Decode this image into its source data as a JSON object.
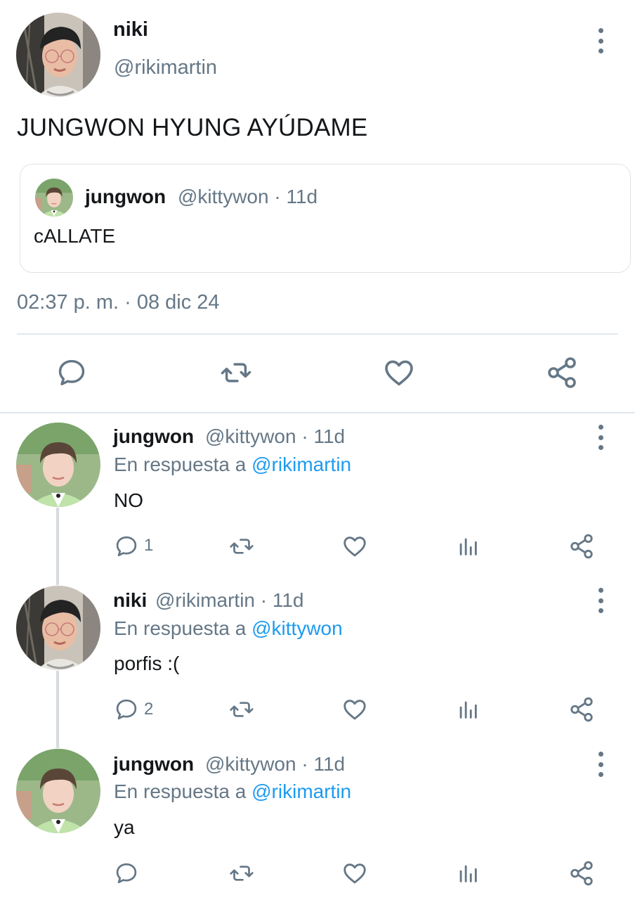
{
  "main_tweet": {
    "name": "niki",
    "handle": "@rikimartin",
    "text": "JUNGWON HYUNG AYÚDAME",
    "timestamp": "02:37 p. m. · 08 dic 24",
    "avatar_icon": "avatar-niki",
    "more_icon": "more-vertical-icon",
    "quote": {
      "name": "jungwon",
      "meta": "@kittywon · 11d",
      "text": "cALLATE",
      "avatar_icon": "avatar-jungwon"
    },
    "actions": [
      "reply-icon",
      "retweet-icon",
      "like-icon",
      "share-icon"
    ]
  },
  "replies": [
    {
      "name": "jungwon",
      "meta": "@kittywon · 11d",
      "reply_prefix": "En respuesta a ",
      "reply_to": "@rikimartin",
      "text": "NO",
      "reply_count": "1",
      "avatar_icon": "avatar-jungwon"
    },
    {
      "name": "niki",
      "meta": "@rikimartin · 11d",
      "reply_prefix": "En respuesta a ",
      "reply_to": "@kittywon",
      "text": "porfis :(",
      "reply_count": "2",
      "avatar_icon": "avatar-niki"
    },
    {
      "name": "jungwon",
      "meta": "@kittywon · 11d",
      "reply_prefix": "En respuesta a ",
      "reply_to": "@rikimartin",
      "text": "ya",
      "reply_count": "",
      "avatar_icon": "avatar-jungwon"
    }
  ],
  "colors": {
    "text": "#14171a",
    "muted": "#657786",
    "accent": "#1d9bf0",
    "divider": "#e1e8ed"
  }
}
